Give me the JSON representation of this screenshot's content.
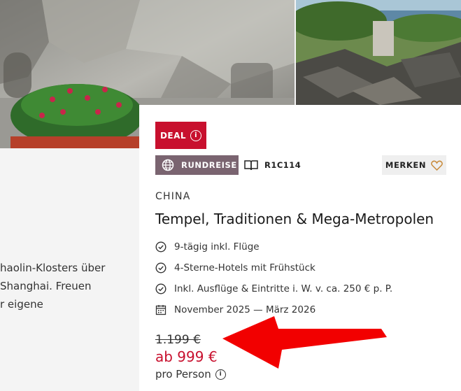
{
  "left_description": {
    "lines": [
      "haolin-Klosters über",
      "Shanghai. Freuen",
      "r eigene"
    ]
  },
  "card": {
    "deal_badge": "DEAL",
    "deal_info_glyph": "i",
    "trip_type": "RUNDREISE",
    "trip_code": "R1C114",
    "merken_label": "MERKEN",
    "country": "CHINA",
    "title": "Tempel, Traditionen & Mega-Metropolen",
    "features": [
      {
        "icon": "check-circle-icon",
        "text": "9-tägig inkl. Flüge"
      },
      {
        "icon": "check-circle-icon",
        "text": "4-Sterne-Hotels mit Frühstück"
      },
      {
        "icon": "check-circle-icon",
        "text": "Inkl. Ausflüge & Eintritte i. W. v. ca. 250 € p. P."
      },
      {
        "icon": "calendar-icon",
        "text": "November 2025 — März 2026"
      }
    ],
    "old_price": "1.199 €",
    "new_price": "ab 999 €",
    "per_person": "pro Person",
    "per_person_info_glyph": "i"
  },
  "colors": {
    "accent_red": "#c8102e",
    "chip_purple": "#7a6470",
    "heart_outline": "#c88a3a",
    "arrow_red": "#f20000"
  }
}
